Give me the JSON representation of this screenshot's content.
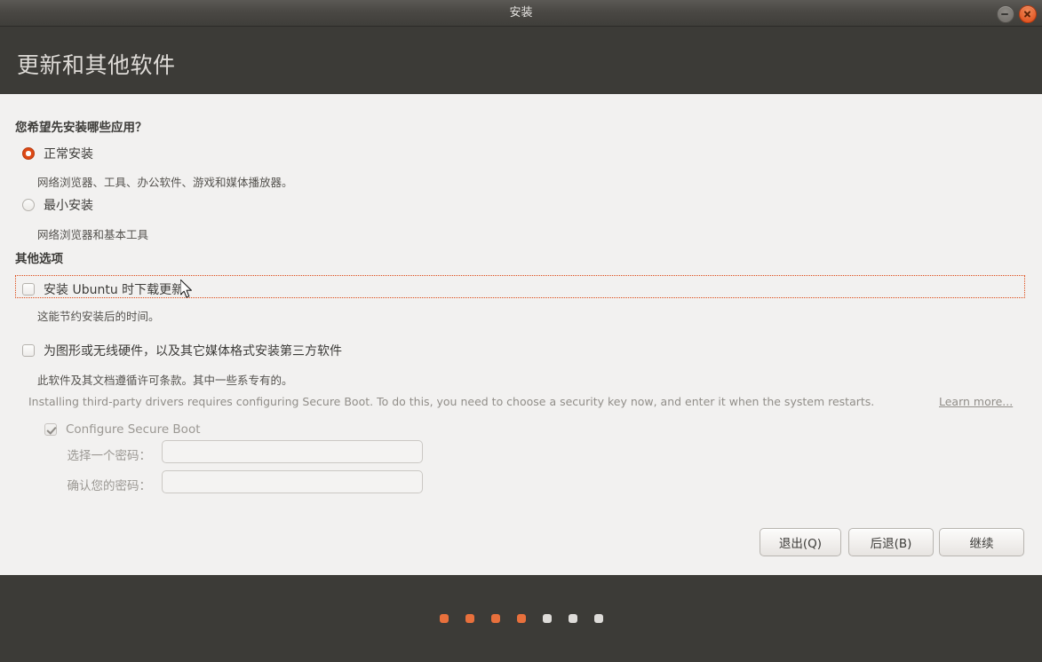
{
  "window": {
    "title": "安装",
    "minimize_label": "最小化",
    "close_label": "关闭"
  },
  "header": {
    "title": "更新和其他软件"
  },
  "apps_section": {
    "question": "您希望先安装哪些应用？",
    "options": [
      {
        "label": "正常安装",
        "description": "网络浏览器、工具、办公软件、游戏和媒体播放器。",
        "selected": true
      },
      {
        "label": "最小安装",
        "description": "网络浏览器和基本工具",
        "selected": false
      }
    ]
  },
  "other_section": {
    "title": "其他选项",
    "download_updates": {
      "label": "安装 Ubuntu 时下载更新",
      "description": "这能节约安装后的时间。",
      "checked": false,
      "focused": true
    },
    "third_party": {
      "label": "为图形或无线硬件，以及其它媒体格式安装第三方软件",
      "description": "此软件及其文档遵循许可条款。其中一些系专有的。",
      "checked": false
    },
    "secure_boot_note": "Installing third-party drivers requires configuring Secure Boot. To do this, you need to choose a security key now, and enter it when the system restarts.",
    "learn_more": "Learn more...",
    "configure_secure_boot": {
      "label": "Configure Secure Boot",
      "checked": true,
      "disabled": true
    },
    "password_fields": [
      {
        "label": "选择一个密码：",
        "value": "",
        "placeholder": ""
      },
      {
        "label": "确认您的密码：",
        "value": "",
        "placeholder": ""
      }
    ]
  },
  "buttons": {
    "quit": "退出(Q)",
    "back": "后退(B)",
    "continue": "继续"
  },
  "progress": {
    "total_steps": 7,
    "completed_steps": 4,
    "active_color": "#e8703c",
    "inactive_color": "#dedcd9"
  },
  "theme": {
    "accent": "#dd4814",
    "header_bg": "#3c3b37",
    "content_bg": "#f2f1f0"
  }
}
